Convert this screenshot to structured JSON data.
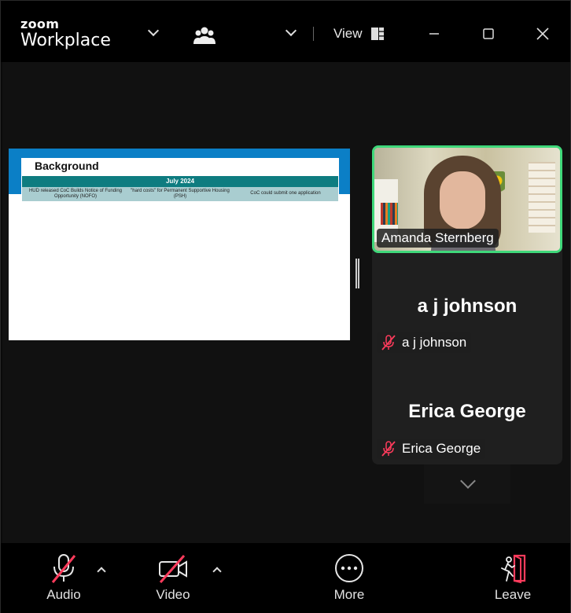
{
  "app": {
    "logo_top": "zoom",
    "logo_bottom": "Workplace",
    "view_label": "View"
  },
  "slide": {
    "title": "Background",
    "header": "July 2024",
    "cells": [
      "HUD released CoC Builds Notice of Funding Opportunity (NOFO)",
      "\"hard costs\" for Permanent Supportive Housing (PSH)",
      "CoC could submit one application"
    ]
  },
  "participants": {
    "active": {
      "name": "Amanda Sternberg"
    },
    "others": [
      {
        "display_name": "a j johnson",
        "tag": "a j johnson",
        "muted": true
      },
      {
        "display_name": "Erica George",
        "tag": "Erica George",
        "muted": true
      }
    ]
  },
  "toolbar": {
    "audio_label": "Audio",
    "video_label": "Video",
    "more_label": "More",
    "leave_label": "Leave"
  },
  "colors": {
    "active_speaker_border": "#3fd87a",
    "leave_icon": "#ff3b5c",
    "muted_slash": "#ff3b5c",
    "slide_band": "#0b7fc6",
    "slide_header": "#0e7c80"
  },
  "icons": [
    "chevron-down-icon",
    "participants-icon",
    "view-grid-icon",
    "minimize-icon",
    "maximize-icon",
    "close-icon",
    "mic-muted-icon",
    "video-off-icon",
    "more-icon",
    "leave-icon"
  ]
}
